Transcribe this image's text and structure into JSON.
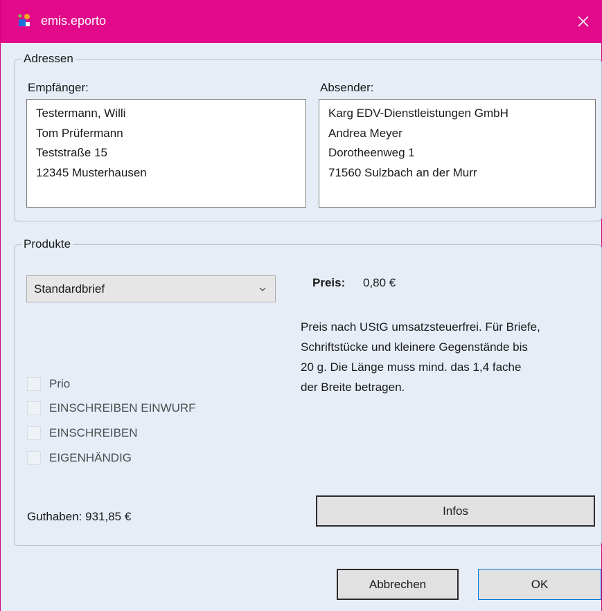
{
  "window": {
    "title": "emis.eporto",
    "accent": "#e20a8a",
    "close_icon": "close-icon"
  },
  "addresses": {
    "legend": "Adressen",
    "recipient": {
      "label": "Empfänger:",
      "lines": [
        "Testermann, Willi",
        "Tom Prüfermann",
        "Teststraße 15",
        "12345 Musterhausen"
      ]
    },
    "sender": {
      "label": "Absender:",
      "lines": [
        "Karg EDV-Dienstleistungen GmbH",
        "Andrea Meyer",
        "Dorotheenweg 1",
        "71560 Sulzbach an der Murr"
      ]
    }
  },
  "products": {
    "legend": "Produkte",
    "selected_product": "Standardbrief",
    "price_label": "Preis:",
    "price_value": "0,80 €",
    "description_lines": [
      "Preis nach UStG umsatzsteuerfrei. Für Briefe,",
      "Schriftstücke und kleinere Gegenstände bis",
      "20 g. Die Länge muss mind. das 1,4 fache",
      "der Breite betragen."
    ],
    "options": [
      {
        "label": "Prio",
        "checked": false,
        "enabled": false
      },
      {
        "label": "EINSCHREIBEN EINWURF",
        "checked": false,
        "enabled": false
      },
      {
        "label": "EINSCHREIBEN",
        "checked": false,
        "enabled": false
      },
      {
        "label": "EIGENHÄNDIG",
        "checked": false,
        "enabled": false
      }
    ],
    "credit": "Guthaben: 931,85 €",
    "infos_button": "Infos"
  },
  "footer": {
    "cancel_label": "Abbrechen",
    "ok_label": "OK"
  }
}
